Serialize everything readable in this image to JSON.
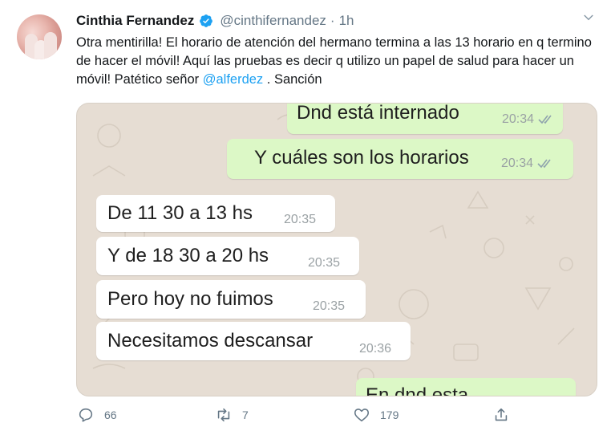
{
  "tweet": {
    "author_name": "Cinthia Fernandez",
    "handle": "@cinthifernandez",
    "separator": "·",
    "time": "1h",
    "text_part1": "Otra mentirilla! El horario de atención del hermano termina a las 13 horario en q termino de hacer el móvil! Aquí las pruebas es decir q utilizo un papel de salud para hacer un móvil! Patético señor ",
    "mention": "@alferdez",
    "text_part2": " . Sanción"
  },
  "chat": {
    "messages": [
      {
        "text": "Dnd está internado",
        "time": "20:34",
        "direction": "outgoing",
        "read": true
      },
      {
        "text": "Y cuáles son los horarios",
        "time": "20:34",
        "direction": "outgoing",
        "read": true
      },
      {
        "text": "De 11 30 a 13 hs",
        "time": "20:35",
        "direction": "incoming"
      },
      {
        "text": "Y de 18 30 a 20 hs",
        "time": "20:35",
        "direction": "incoming"
      },
      {
        "text": "Pero hoy no fuimos",
        "time": "20:35",
        "direction": "incoming"
      },
      {
        "text": "Necesitamos descansar",
        "time": "20:36",
        "direction": "incoming"
      },
      {
        "text": "En dnd esta",
        "direction": "outgoing",
        "partially_visible": true
      }
    ],
    "colors": {
      "outgoing": "#dcf8c6",
      "incoming": "#ffffff",
      "wallpaper": "#e6ddd3",
      "read_ticks": "#8fa3ad"
    }
  },
  "actions": {
    "reply_count": "66",
    "retweet_count": "7",
    "like_count": "179",
    "icons": [
      "reply-icon",
      "retweet-icon",
      "like-icon",
      "share-icon"
    ]
  },
  "colors": {
    "accent": "#1da1f2",
    "muted": "#657786",
    "text": "#14171a"
  }
}
